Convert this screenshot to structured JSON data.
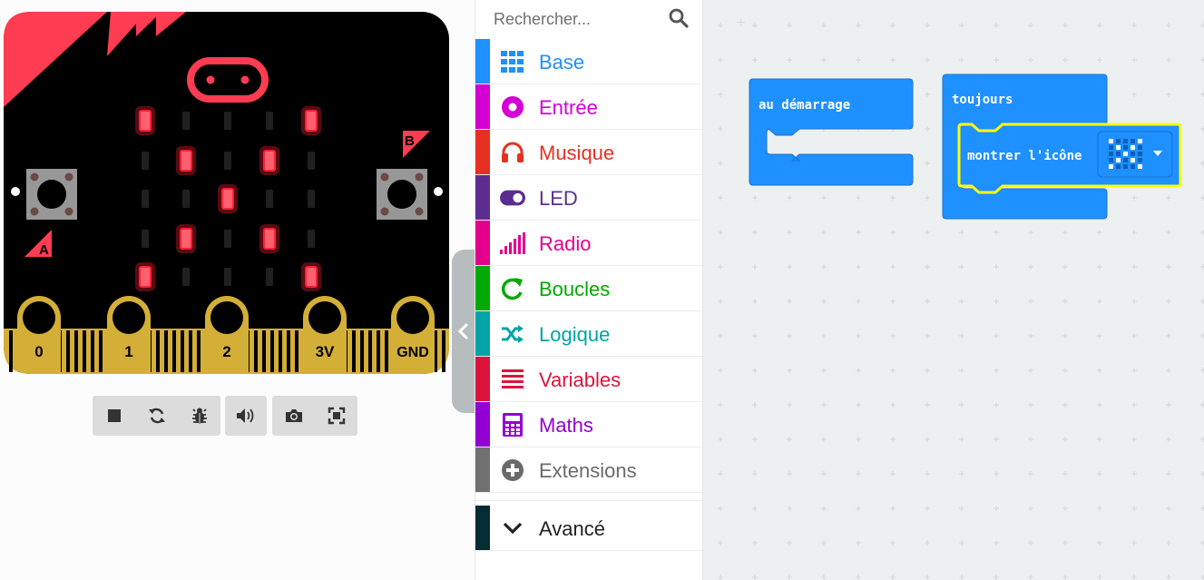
{
  "simulator": {
    "pins": [
      "0",
      "1",
      "2",
      "3V",
      "GND"
    ],
    "button_a_label": "A",
    "button_b_label": "B",
    "led_matrix": [
      [
        1,
        0,
        0,
        0,
        1
      ],
      [
        0,
        1,
        0,
        1,
        0
      ],
      [
        0,
        0,
        1,
        0,
        0
      ],
      [
        0,
        1,
        0,
        1,
        0
      ],
      [
        1,
        0,
        0,
        0,
        1
      ]
    ],
    "controls": [
      "stop-icon",
      "restart-icon",
      "debug-icon",
      "sound-icon",
      "screenshot-icon",
      "fullscreen-icon"
    ]
  },
  "toolbox": {
    "search": {
      "placeholder": "Rechercher...",
      "value": ""
    },
    "categories": [
      {
        "label": "Base",
        "color": "#1e90ff",
        "icon": "grid-icon"
      },
      {
        "label": "Entrée",
        "color": "#d400d4",
        "icon": "input-icon"
      },
      {
        "label": "Musique",
        "color": "#e63022",
        "icon": "headphones-icon"
      },
      {
        "label": "LED",
        "color": "#5c2d91",
        "icon": "toggle-icon"
      },
      {
        "label": "Radio",
        "color": "#e3008c",
        "icon": "signal-icon"
      },
      {
        "label": "Boucles",
        "color": "#00aa00",
        "icon": "loop-icon"
      },
      {
        "label": "Logique",
        "color": "#00a4a6",
        "icon": "shuffle-icon"
      },
      {
        "label": "Variables",
        "color": "#dc143c",
        "icon": "list-icon"
      },
      {
        "label": "Maths",
        "color": "#9400d3",
        "icon": "calculator-icon"
      },
      {
        "label": "Extensions",
        "color": "#717171",
        "icon": "plus-circle-icon"
      }
    ],
    "advanced": {
      "label": "Avancé",
      "color": "#012d33",
      "icon": "chevron-down-icon"
    }
  },
  "workspace": {
    "on_start_block": {
      "label": "au démarrage",
      "color": "#1e90ff"
    },
    "forever_block": {
      "label": "toujours",
      "color": "#1e90ff"
    },
    "show_icon_block": {
      "label": "montrer l'icône",
      "color": "#1e90ff",
      "highlight": "#ffff00",
      "icon_matrix": [
        [
          1,
          0,
          0,
          0,
          1
        ],
        [
          0,
          1,
          0,
          1,
          0
        ],
        [
          0,
          0,
          1,
          0,
          0
        ],
        [
          0,
          1,
          0,
          1,
          0
        ],
        [
          1,
          0,
          0,
          0,
          1
        ]
      ]
    }
  }
}
